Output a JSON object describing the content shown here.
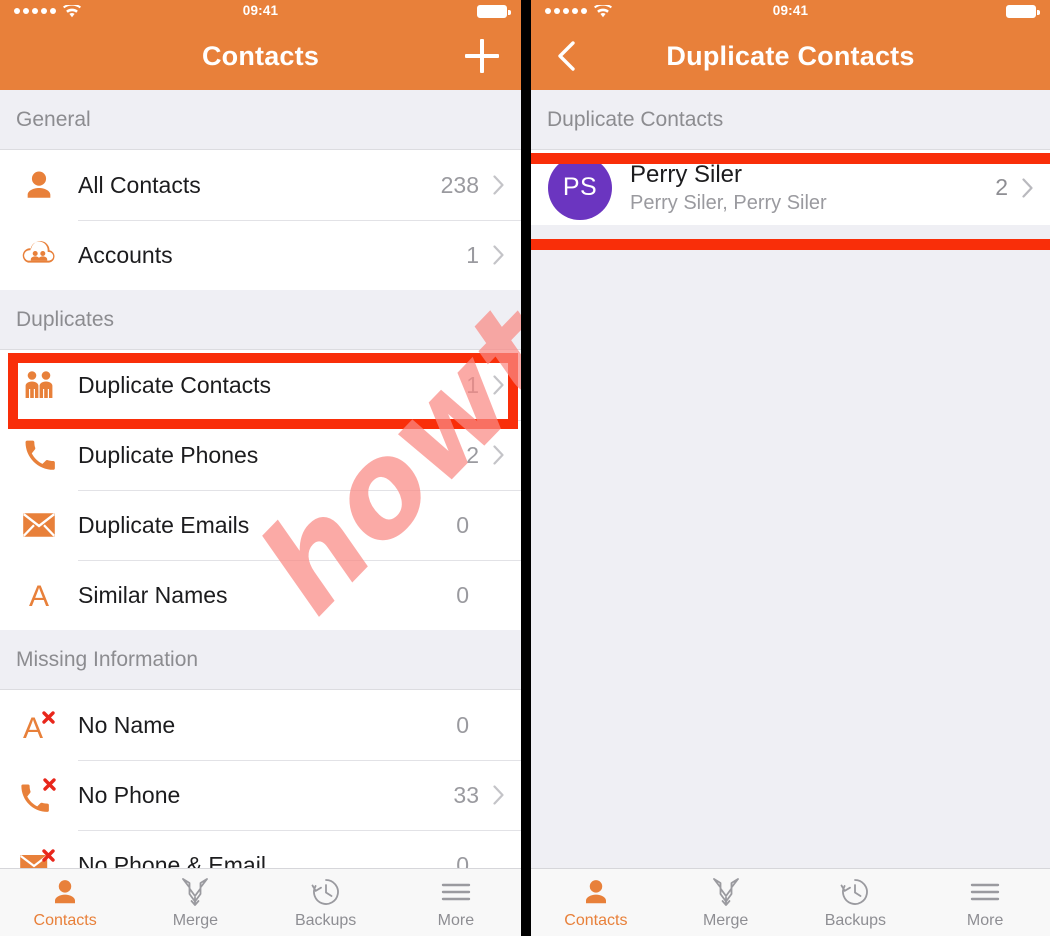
{
  "status_bar": {
    "time": "09:41",
    "signal_dots": 5,
    "wifi_icon": "wifi-icon",
    "battery_icon": "battery-full-icon"
  },
  "colors": {
    "header_orange": "#E8803A",
    "accent_orange": "#E8803A",
    "highlight_red": "#F92E09",
    "avatar_purple": "#6B35C0",
    "watermark": "#fa8a85"
  },
  "watermark": {
    "text": "howtech"
  },
  "left_panel": {
    "nav": {
      "title": "Contacts",
      "add_button": "+",
      "add_icon": "plus-icon"
    },
    "sections": [
      {
        "header": "General",
        "rows": [
          {
            "icon": "person-icon",
            "label": "All Contacts",
            "count": "238",
            "chevron": true
          },
          {
            "icon": "cloud-people-icon",
            "label": "Accounts",
            "count": "1",
            "chevron": true
          }
        ]
      },
      {
        "header": "Duplicates",
        "rows": [
          {
            "icon": "two-people-icon",
            "label": "Duplicate Contacts",
            "count": "1",
            "chevron": true,
            "highlighted": true
          },
          {
            "icon": "phone-icon",
            "label": "Duplicate Phones",
            "count": "2",
            "chevron": true
          },
          {
            "icon": "envelope-icon",
            "label": "Duplicate Emails",
            "count": "0",
            "chevron": false
          },
          {
            "icon": "letter-a-icon",
            "label": "Similar Names",
            "count": "0",
            "chevron": false
          }
        ]
      },
      {
        "header": "Missing Information",
        "rows": [
          {
            "icon": "letter-a-x-icon",
            "label": "No Name",
            "count": "0",
            "chevron": false
          },
          {
            "icon": "phone-x-icon",
            "label": "No Phone",
            "count": "33",
            "chevron": true
          },
          {
            "icon": "envelope-x-icon",
            "label": "No Phone & Email",
            "count": "0",
            "chevron": false
          }
        ]
      }
    ]
  },
  "right_panel": {
    "nav": {
      "title": "Duplicate Contacts",
      "back_icon": "chevron-left-icon"
    },
    "section_header": "Duplicate Contacts",
    "contacts": [
      {
        "initials": "PS",
        "name": "Perry Siler",
        "subtitle": "Perry Siler, Perry Siler",
        "count": "2",
        "highlighted": true
      }
    ]
  },
  "tab_bar": {
    "tabs": [
      {
        "icon": "person-icon",
        "label": "Contacts",
        "active": true
      },
      {
        "icon": "merge-icon",
        "label": "Merge",
        "active": false
      },
      {
        "icon": "backups-icon",
        "label": "Backups",
        "active": false
      },
      {
        "icon": "more-icon",
        "label": "More",
        "active": false
      }
    ]
  }
}
